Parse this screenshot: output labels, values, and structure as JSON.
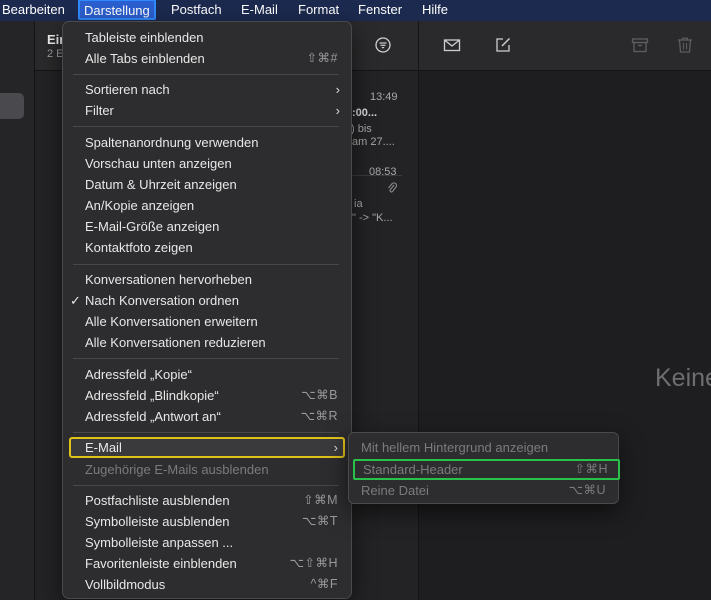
{
  "menubar": {
    "items": [
      "Bearbeiten",
      "Darstellung",
      "Postfach",
      "E-Mail",
      "Format",
      "Fenster",
      "Hilfe"
    ],
    "active": "Darstellung"
  },
  "mailbox": {
    "title": "Ein",
    "subtitle": "2 E",
    "messages": [
      {
        "time": "13:49",
        "line1": ":00...",
        "line2": ") bis",
        "line3": "am 27...."
      },
      {
        "time": "08:53",
        "line2": "ia",
        "line3": "\" -> \"K..."
      }
    ]
  },
  "reading_pane": {
    "empty_text": "Keine"
  },
  "view_menu": {
    "items": [
      {
        "label": "Tableiste einblenden"
      },
      {
        "label": "Alle Tabs einblenden",
        "shortcut": "⇧⌘#"
      },
      {
        "label": "Sortieren nach",
        "submenu": true
      },
      {
        "label": "Filter",
        "submenu": true
      },
      {
        "label": "Spaltenanordnung verwenden"
      },
      {
        "label": "Vorschau unten anzeigen"
      },
      {
        "label": "Datum & Uhrzeit anzeigen"
      },
      {
        "label": "An/Kopie anzeigen"
      },
      {
        "label": "E-Mail-Größe anzeigen"
      },
      {
        "label": "Kontaktfoto zeigen"
      },
      {
        "label": "Konversationen hervorheben"
      },
      {
        "label": "Nach Konversation ordnen",
        "checked": true,
        "check_mark": "✓"
      },
      {
        "label": "Alle Konversationen erweitern"
      },
      {
        "label": "Alle Konversationen reduzieren"
      },
      {
        "label": "Adressfeld „Kopie“"
      },
      {
        "label": "Adressfeld „Blindkopie“",
        "shortcut": "⌥⌘B"
      },
      {
        "label": "Adressfeld „Antwort an“",
        "shortcut": "⌥⌘R"
      },
      {
        "label": "E-Mail",
        "submenu": true,
        "highlighted": true
      },
      {
        "label": "Zugehörige E-Mails ausblenden",
        "disabled": true
      },
      {
        "label": "Postfachliste ausblenden",
        "shortcut": "⇧⌘M"
      },
      {
        "label": "Symbolleiste ausblenden",
        "shortcut": "⌥⌘T"
      },
      {
        "label": "Symbolleiste anpassen ..."
      },
      {
        "label": "Favoritenleiste einblenden",
        "shortcut": "⌥⇧⌘H"
      },
      {
        "label": "Vollbildmodus",
        "shortcut": "^⌘F"
      }
    ],
    "submenu_arrow": "›"
  },
  "email_submenu": {
    "items": [
      {
        "label": "Mit hellem Hintergrund anzeigen",
        "disabled": true
      },
      {
        "label": "Standard-Header",
        "shortcut": "⇧⌘H",
        "disabled": true,
        "outlined": true
      },
      {
        "label": "Reine Datei",
        "shortcut": "⌥⌘U",
        "disabled": true
      }
    ]
  },
  "colors": {
    "menubar_bg": "#1c2a4f",
    "active_menu_bg": "#2c5fcf",
    "menu_bg": "#2d2c2e",
    "highlight_outline": "#e0c21a",
    "submenu_outline": "#28c24a"
  }
}
